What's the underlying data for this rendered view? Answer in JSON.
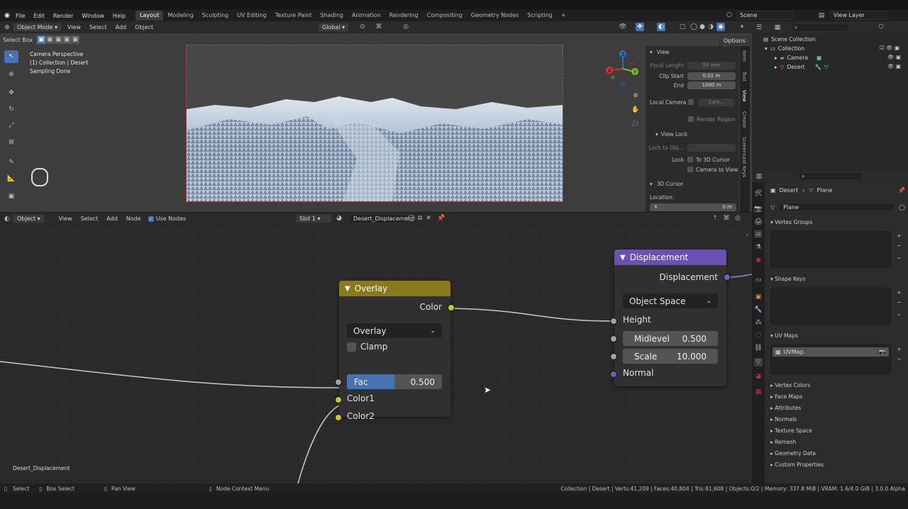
{
  "menu": [
    "File",
    "Edit",
    "Render",
    "Window",
    "Help"
  ],
  "workspaces": [
    "Layout",
    "Modeling",
    "Sculpting",
    "UV Editing",
    "Texture Paint",
    "Shading",
    "Animation",
    "Rendering",
    "Compositing",
    "Geometry Nodes",
    "Scripting"
  ],
  "active_workspace": "Layout",
  "scene": "Scene",
  "view_layer": "View Layer",
  "viewport": {
    "mode": "Object Mode",
    "menus": [
      "View",
      "Select",
      "Add",
      "Object"
    ],
    "orientation": "Global",
    "select_box": "Select Box",
    "options": "Options",
    "overlay_lines": [
      "Camera Perspective",
      "(1) Collection | Desert",
      "Sampling Done"
    ],
    "gizmo": {
      "x": "X",
      "y": "Y",
      "z": "Z"
    }
  },
  "npanel": {
    "view_title": "View",
    "focal_length_label": "Focal Length",
    "focal_length": "50 mm",
    "clip_start_label": "Clip Start",
    "clip_start": "0.01 m",
    "end_label": "End",
    "end": "1000 m",
    "local_camera_label": "Local Camera",
    "local_camera_value": "Cam...",
    "render_region": "Render Region",
    "view_lock_title": "View Lock",
    "lock_to_obj_label": "Lock to Obj...",
    "lock_label": "Lock",
    "to_3d_cursor": "To 3D Cursor",
    "camera_to_view": "Camera to View",
    "cursor_title": "3D Cursor",
    "location_label": "Location:",
    "x_label": "X",
    "x_value": "0 m",
    "tabs": [
      "Item",
      "Tool",
      "View",
      "Create",
      "Screencast Keys"
    ]
  },
  "outliner": {
    "items": [
      "Scene Collection",
      "Collection",
      "Camera",
      "Desert"
    ]
  },
  "properties": {
    "object": "Desert",
    "data": "Plane",
    "mesh_name": "Plane",
    "sections": {
      "vertex_groups": "Vertex Groups",
      "shape_keys": "Shape Keys",
      "uv_maps": "UV Maps",
      "uv_map_item": "UVMap"
    },
    "collapsed": [
      "Vertex Colors",
      "Face Maps",
      "Attributes",
      "Normals",
      "Texture Space",
      "Remesh",
      "Geometry Data",
      "Custom Properties"
    ]
  },
  "node_editor": {
    "type": "Object",
    "menus": [
      "View",
      "Select",
      "Add",
      "Node"
    ],
    "use_nodes": "Use Nodes",
    "slot": "Slot 1",
    "material": "Desert_Displacement",
    "tree_label": "Desert_Displacement",
    "overlay_node": {
      "title": "Overlay",
      "output": "Color",
      "blend": "Overlay",
      "clamp": "Clamp",
      "fac_label": "Fac",
      "fac_value": "0.500",
      "fac_fraction": 0.5,
      "input1": "Color1",
      "input2": "Color2"
    },
    "displacement_node": {
      "title": "Displacement",
      "output": "Displacement",
      "space": "Object Space",
      "height": "Height",
      "midlevel_label": "Midlevel",
      "midlevel_value": "0.500",
      "scale_label": "Scale",
      "scale_value": "10.000",
      "normal": "Normal"
    }
  },
  "status": {
    "select": "Select",
    "box_select": "Box Select",
    "pan_view": "Pan View",
    "context_menu": "Node Context Menu",
    "stats": "Collection | Desert | Verts:41,209 | Faces:40,804 | Tris:81,608 | Objects:0/2 | Memory: 337.8 MiB | VRAM: 1.6/4.0 GiB | 3.0.0 Alpha"
  },
  "colors": {
    "overlay_header": "#8a7a1e",
    "displacement_header": "#6c4fb3",
    "color_socket": "#c7c729",
    "vector_socket": "#6363c7",
    "gray_socket": "#a1a1a1",
    "fac_fill": "#4772b3"
  }
}
